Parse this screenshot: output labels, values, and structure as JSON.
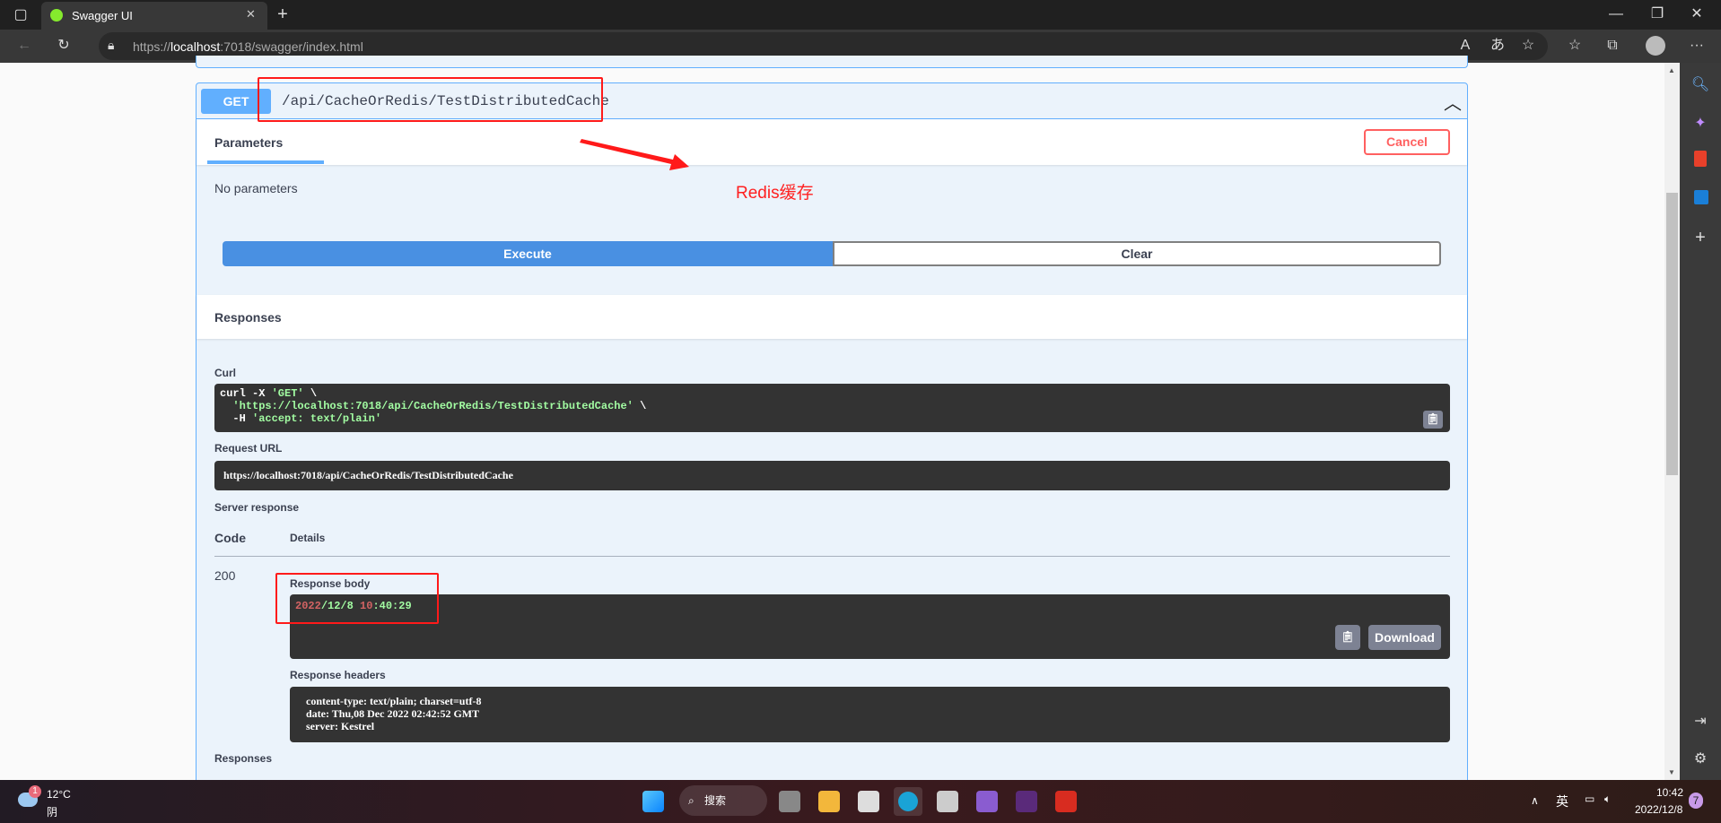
{
  "browser": {
    "tab_title": "Swagger UI",
    "url_prefix": "https://",
    "url_host": "localhost",
    "url_rest": ":7018/swagger/index.html"
  },
  "operation": {
    "method": "GET",
    "path": "/api/CacheOrRedis/TestDistributedCache",
    "method_color": "#61affe"
  },
  "parameters": {
    "tab": "Parameters",
    "cancel": "Cancel",
    "none": "No parameters"
  },
  "annotation": {
    "text": "Redis缓存",
    "color": "#ff2020"
  },
  "actions": {
    "execute": "Execute",
    "clear": "Clear"
  },
  "responses_title": "Responses",
  "curl": {
    "label": "Curl",
    "line1_a": "curl -X ",
    "line1_b": "'GET'",
    "line1_c": " \\",
    "line2_a": "  'https://localhost:7018/api/CacheOrRedis/TestDistributedCache'",
    "line2_b": " \\",
    "line3_a": "  -H ",
    "line3_b": "'accept: text/plain'"
  },
  "request_url": {
    "label": "Request URL",
    "value": "https://localhost:7018/api/CacheOrRedis/TestDistributedCache"
  },
  "server_response": {
    "label": "Server response",
    "code_header": "Code",
    "details_header": "Details",
    "code": "200",
    "body_label": "Response body",
    "body_parts": [
      "2022",
      "/12/8 ",
      "10",
      ":40:29"
    ],
    "download": "Download",
    "headers_label": "Response headers",
    "headers": [
      "content-type: text/plain; charset=utf-8",
      "date: Thu,08 Dec 2022 02:42:52 GMT",
      "server: Kestrel"
    ]
  },
  "responses_footer": "Responses",
  "taskbar": {
    "weather_temp": "12°C",
    "weather_desc": "阴",
    "weather_badge": "1",
    "search": "搜索",
    "ime": "英",
    "time": "10:42",
    "date": "2022/12/8",
    "notifications": "7"
  }
}
